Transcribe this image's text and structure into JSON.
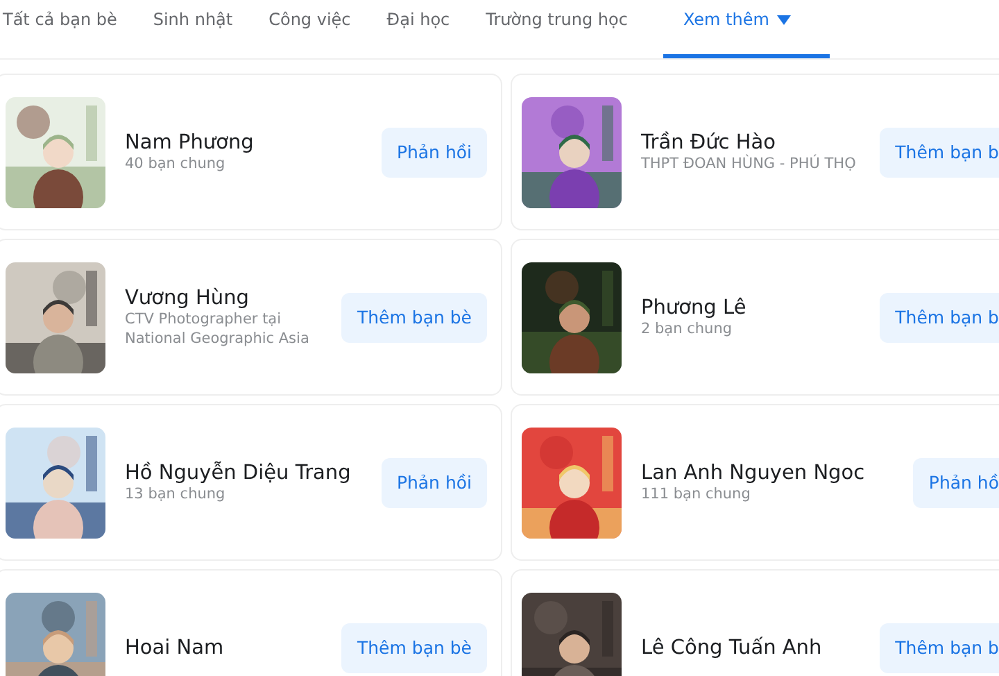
{
  "tabs": [
    {
      "label": "Tất cả bạn bè",
      "selected": false
    },
    {
      "label": "Sinh nhật",
      "selected": false
    },
    {
      "label": "Công việc",
      "selected": false
    },
    {
      "label": "Đại học",
      "selected": false
    },
    {
      "label": "Trường trung học",
      "selected": false
    },
    {
      "label": "Xem thêm",
      "selected": true,
      "dropdown": true
    }
  ],
  "people": [
    {
      "name": "Nam Phương",
      "subtitle": "40 bạn chung",
      "button": "Phản hồi"
    },
    {
      "name": "Trần Đức Hào",
      "subtitle": "THPT ĐOAN HÙNG - PHÚ THỌ",
      "button": "Thêm bạn b"
    },
    {
      "name": "Vương Hùng",
      "subtitle": "CTV Photographer tại National Geographic Asia",
      "button": "Thêm bạn bè"
    },
    {
      "name": "Phương Lê",
      "subtitle": "2 bạn chung",
      "button": "Thêm bạn b"
    },
    {
      "name": "Hồ Nguyễn Diệu Trang",
      "subtitle": "13 bạn chung",
      "button": "Phản hồi"
    },
    {
      "name": "Lan Anh Nguyen Ngoc",
      "subtitle": "111 bạn chung",
      "button": "Phản hồ"
    },
    {
      "name": "Hoai Nam",
      "button": "Thêm bạn bè"
    },
    {
      "name": "Lê Công Tuấn Anh",
      "button": "Thêm bạn b"
    }
  ]
}
